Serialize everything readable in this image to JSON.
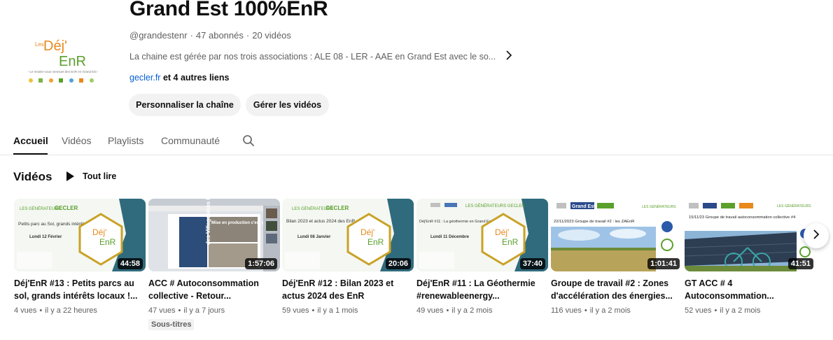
{
  "channel": {
    "name": "Grand Est 100%ÉnR",
    "handle": "@grandestenr",
    "subscribers": "47 abonnés",
    "videos_count": "20 vidéos",
    "description": "La chaine est gérée par nos trois associations : ALE 08 - LER - AAE en Grand Est avec le so...",
    "link": "gecler.fr",
    "other_links": "et 4 autres liens",
    "avatar_logo": {
      "line1": "Les",
      "line2": "Déj'",
      "line3": "EnR",
      "tagline": "- Le rendez-vous mensuel des EnR en Grand Est -"
    }
  },
  "buttons": {
    "customize": "Personnaliser la chaîne",
    "manage": "Gérer les vidéos"
  },
  "tabs": [
    {
      "label": "Accueil",
      "active": true
    },
    {
      "label": "Vidéos",
      "active": false
    },
    {
      "label": "Playlists",
      "active": false
    },
    {
      "label": "Communauté",
      "active": false
    }
  ],
  "section": {
    "title": "Vidéos",
    "play_all": "Tout lire"
  },
  "videos": [
    {
      "title": "Déj'EnR #13 : Petits parcs au sol, grands intérêts locaux !...",
      "duration": "44:58",
      "views": "4 vues",
      "age": "il y a 22 heures",
      "badge": "",
      "thumb_text": {
        "head": "Petits parc au Sol, grands intérêts locaux !",
        "date": "Lundi 12 Février",
        "logo1": "Déj'",
        "logo2": "EnR"
      }
    },
    {
      "title": "ACC # Autoconsommation collective - Retour...",
      "duration": "1:57:06",
      "views": "47 vues",
      "age": "il y a 7 jours",
      "badge": "Sous-titres",
      "thumb_text": {
        "head": "Mise en production c'est parti !",
        "side": "des Villageoises Ecoze en Piémont"
      }
    },
    {
      "title": "Déj'EnR #12 : Bilan 2023 et actus 2024 des EnR",
      "duration": "20:06",
      "views": "59 vues",
      "age": "il y a 1 mois",
      "badge": "",
      "thumb_text": {
        "head": "Bilan 2023 et actus 2024 des EnR",
        "date": "Lundi 08 Janvier",
        "logo1": "Déj'",
        "logo2": "EnR"
      }
    },
    {
      "title": "Déj'EnR #11 : La Géothermie #renewableenergy...",
      "duration": "37:40",
      "views": "49 vues",
      "age": "il y a 2 mois",
      "badge": "",
      "thumb_text": {
        "head": "Déj'EnR #11 : La géothermie en Grand Est",
        "date": "Lundi 11 Décembre",
        "logo1": "Déj'",
        "logo2": "EnR"
      }
    },
    {
      "title": "Groupe de travail #2 : Zones d'accélération des énergies...",
      "duration": "1:01:41",
      "views": "116 vues",
      "age": "il y a 2 mois",
      "badge": "",
      "thumb_text": {
        "head": "22/11/2023 Groupe de travail #2 : les ZAEnR",
        "brand": "Grand Est"
      }
    },
    {
      "title": "GT ACC # 4 Autoconsommation...",
      "duration": "41:51",
      "views": "52 vues",
      "age": "il y a 2 mois",
      "badge": "",
      "thumb_text": {
        "head": "15/11/23 Groupe de travail autoconsommation collective #4"
      }
    }
  ],
  "colors": {
    "accent_link": "#065fd4",
    "logo_orange": "#e8891c",
    "logo_green": "#5aa02c",
    "frame_teal": "#2f6b7c",
    "frame_gold": "#c9a227"
  },
  "icons": {
    "search": "search-icon",
    "chevron": "chevron-right-icon",
    "play": "play-icon"
  }
}
